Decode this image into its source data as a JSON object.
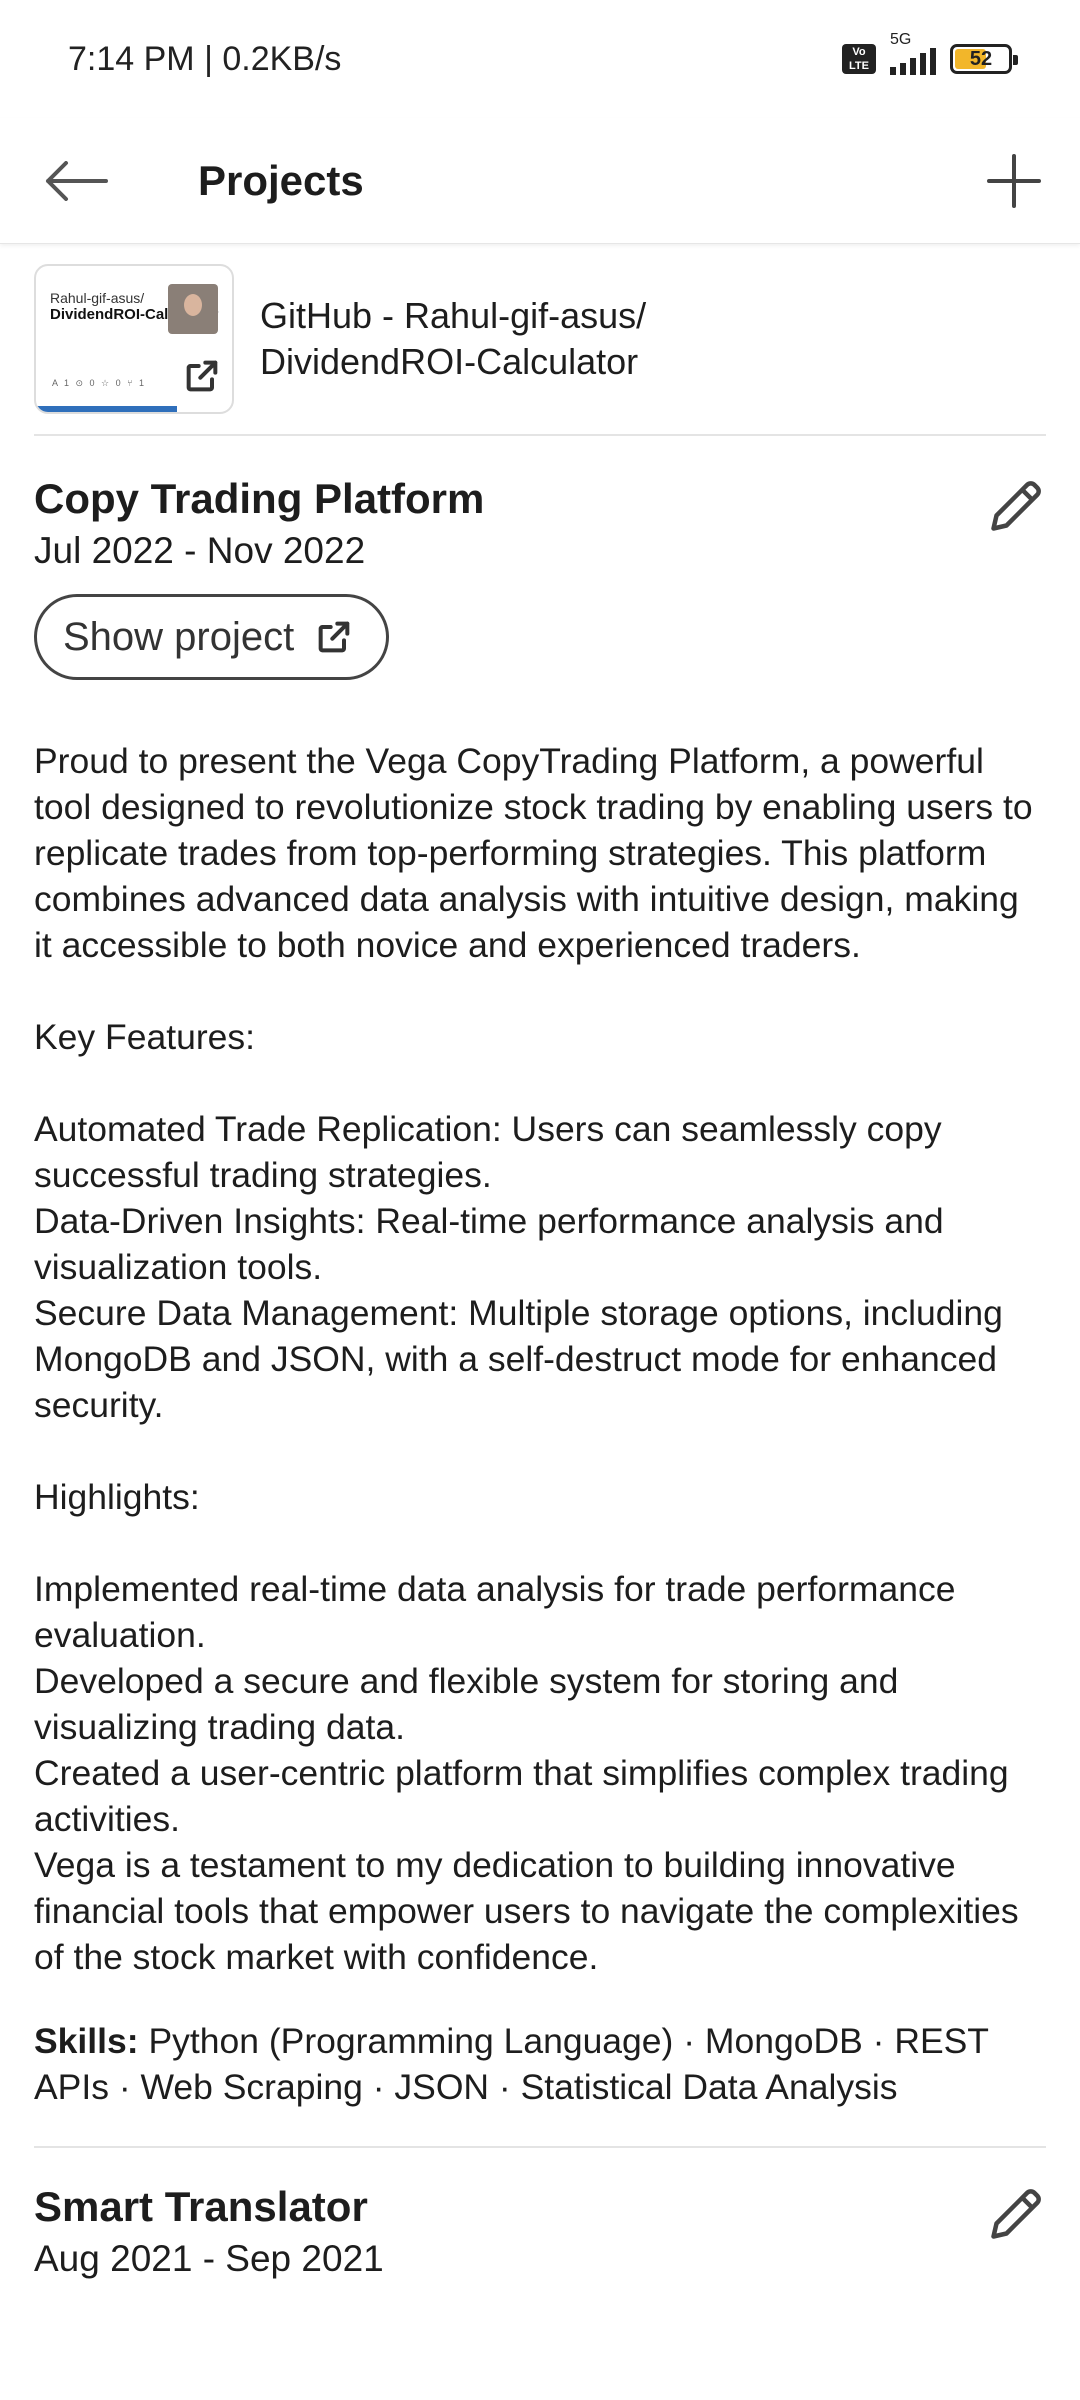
{
  "status_bar": {
    "time": "7:14 PM | 0.2KB/s",
    "volte": "Vo LTE",
    "network": "5G",
    "battery": "52"
  },
  "header": {
    "title": "Projects"
  },
  "link_card": {
    "thumb_owner": "Rahul-gif-asus/",
    "thumb_repo": "DividendROI-Calculator",
    "thumb_meta": "A 1   ⊙ 0   ☆ 0   ⑂ 1",
    "title_line1": "GitHub - Rahul-gif-asus/",
    "title_line2": "DividendROI-Calculator"
  },
  "project": {
    "title": "Copy Trading Platform",
    "dates": "Jul 2022 - Nov 2022",
    "show_label": "Show project",
    "description": [
      "Proud to present the Vega CopyTrading Platform, a powerful tool designed to revolutionize stock trading by enabling users to replicate trades from top-performing strategies. This platform combines advanced data analysis with intuitive design, making it accessible to both novice and experienced traders.",
      "",
      "Key Features:",
      "",
      "Automated Trade Replication: Users can seamlessly copy successful trading strategies.",
      "Data-Driven Insights: Real-time performance analysis and visualization tools.",
      "Secure Data Management: Multiple storage options, including MongoDB and JSON, with a self-destruct mode for enhanced security.",
      "",
      "Highlights:",
      "",
      "Implemented real-time data analysis for trade performance evaluation.",
      "Developed a secure and flexible system for storing and visualizing trading data.",
      "Created a user-centric platform that simplifies complex trading activities.",
      "Vega is a testament to my dedication to building innovative financial tools that empower users to navigate the complexities of the stock market with confidence."
    ],
    "skills_label": "Skills:",
    "skills": "Python (Programming Language) · MongoDB · REST APIs · Web Scraping · JSON · Statistical Data Analysis"
  },
  "project2": {
    "title": "Smart Translator",
    "dates": "Aug 2021 - Sep 2021"
  }
}
